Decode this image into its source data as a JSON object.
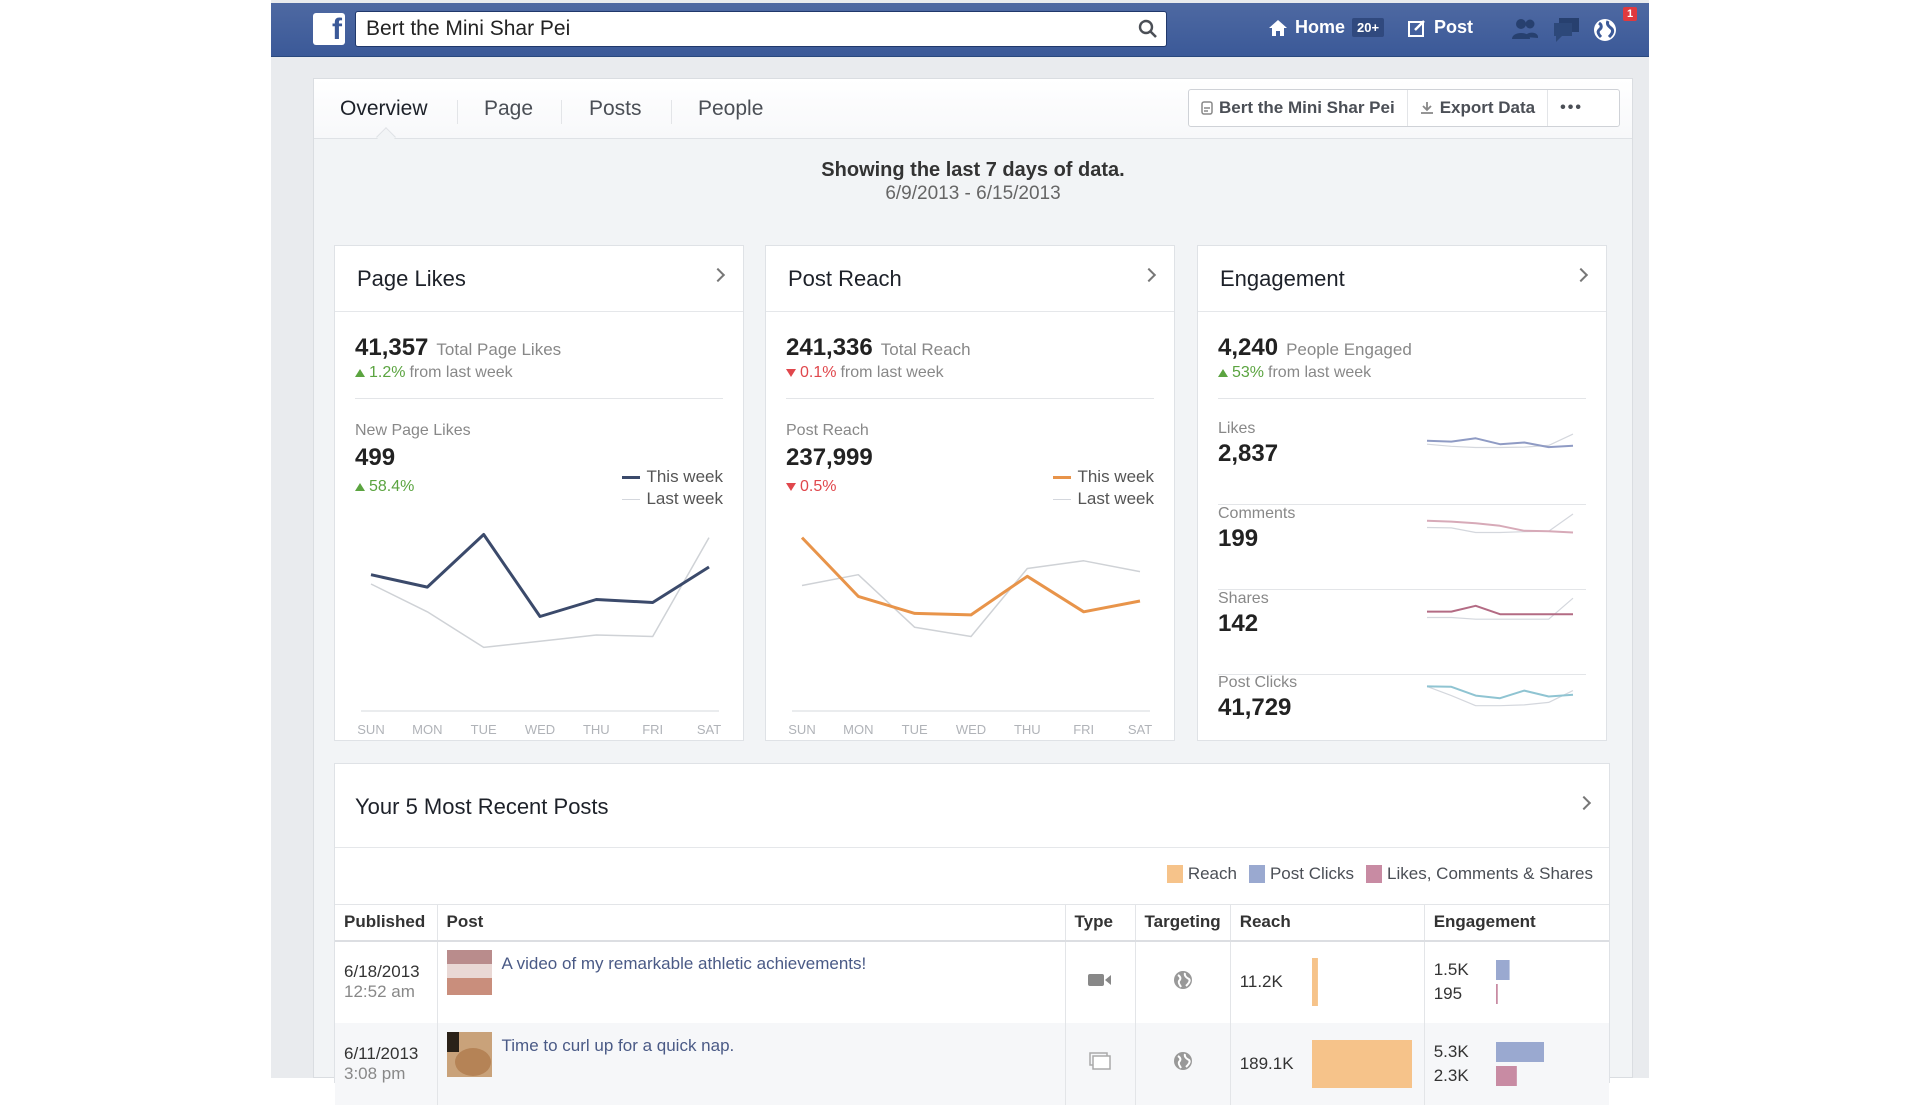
{
  "topbar": {
    "logo": "f",
    "search_value": "Bert the Mini Shar Pei",
    "nav": [
      {
        "label": "Home",
        "badge": "20+",
        "icon": "home-icon"
      },
      {
        "label": "Post",
        "icon": "post-edit-icon"
      }
    ],
    "jewels": [
      {
        "icon": "friend-requests-icon"
      },
      {
        "icon": "messages-icon"
      },
      {
        "icon": "notifications-globe-icon",
        "count": "1"
      }
    ]
  },
  "tabs": [
    {
      "label": "Overview",
      "active": true
    },
    {
      "label": "Page",
      "active": false
    },
    {
      "label": "Posts",
      "active": false
    },
    {
      "label": "People",
      "active": false
    }
  ],
  "actions": {
    "page_label": "Bert the Mini Shar Pei",
    "export_label": "Export Data",
    "more_label": "•••"
  },
  "range": {
    "title": "Showing the last 7 days of data.",
    "dates": "6/9/2013 - 6/15/2013"
  },
  "cards": {
    "page_likes": {
      "title": "Page Likes",
      "total": "41,357",
      "total_label": "Total Page Likes",
      "change": "1.2%",
      "change_dir": "up",
      "change_suffix": "from last week",
      "sub_label": "New Page Likes",
      "sub_value": "499",
      "sub_change": "58.4%",
      "sub_change_dir": "up",
      "legend_this": "This week",
      "legend_last": "Last week"
    },
    "post_reach": {
      "title": "Post Reach",
      "total": "241,336",
      "total_label": "Total Reach",
      "change": "0.1%",
      "change_dir": "down",
      "change_suffix": "from last week",
      "sub_label": "Post Reach",
      "sub_value": "237,999",
      "sub_change": "0.5%",
      "sub_change_dir": "down",
      "legend_this": "This week",
      "legend_last": "Last week"
    },
    "engagement": {
      "title": "Engagement",
      "total": "4,240",
      "total_label": "People Engaged",
      "change": "53%",
      "change_dir": "up",
      "change_suffix": "from last week",
      "rows": [
        {
          "label": "Likes",
          "value": "2,837"
        },
        {
          "label": "Comments",
          "value": "199"
        },
        {
          "label": "Shares",
          "value": "142"
        },
        {
          "label": "Post Clicks",
          "value": "41,729"
        }
      ]
    }
  },
  "chart_data": [
    {
      "type": "line",
      "title": "New Page Likes",
      "categories": [
        "SUN",
        "MON",
        "TUE",
        "WED",
        "THU",
        "FRI",
        "SAT"
      ],
      "series": [
        {
          "name": "This week",
          "color": "#3b4a6b",
          "values": [
            72,
            64,
            98,
            45,
            56,
            54,
            77
          ]
        },
        {
          "name": "Last week",
          "color": "#cfd2d6",
          "values": [
            66,
            48,
            25,
            29,
            33,
            32,
            96
          ]
        }
      ],
      "ylim": [
        0,
        110
      ]
    },
    {
      "type": "line",
      "title": "Post Reach",
      "categories": [
        "SUN",
        "MON",
        "TUE",
        "WED",
        "THU",
        "FRI",
        "SAT"
      ],
      "series": [
        {
          "name": "This week",
          "color": "#e8944a",
          "values": [
            96,
            58,
            47,
            46,
            71,
            48,
            55
          ]
        },
        {
          "name": "Last week",
          "color": "#cfd2d6",
          "values": [
            65,
            72,
            38,
            32,
            76,
            81,
            74
          ]
        }
      ],
      "ylim": [
        0,
        110
      ]
    },
    {
      "type": "line",
      "title": "Likes",
      "categories": [
        "SUN",
        "MON",
        "TUE",
        "WED",
        "THU",
        "FRI",
        "SAT"
      ],
      "series": [
        {
          "name": "This week",
          "color": "#8f9bc4",
          "values": [
            60,
            58,
            66,
            52,
            56,
            45,
            48
          ]
        },
        {
          "name": "Last week",
          "color": "#d4d7dd",
          "values": [
            52,
            47,
            44,
            44,
            45,
            49,
            76
          ]
        }
      ],
      "ylim": [
        0,
        100
      ]
    },
    {
      "type": "line",
      "title": "Comments",
      "categories": [
        "SUN",
        "MON",
        "TUE",
        "WED",
        "THU",
        "FRI",
        "SAT"
      ],
      "series": [
        {
          "name": "This week",
          "color": "#d7aab8",
          "values": [
            72,
            70,
            66,
            60,
            48,
            47,
            44
          ]
        },
        {
          "name": "Last week",
          "color": "#d4d7dd",
          "values": [
            56,
            55,
            44,
            44,
            46,
            47,
            88
          ]
        }
      ],
      "ylim": [
        0,
        100
      ]
    },
    {
      "type": "line",
      "title": "Shares",
      "categories": [
        "SUN",
        "MON",
        "TUE",
        "WED",
        "THU",
        "FRI",
        "SAT"
      ],
      "series": [
        {
          "name": "This week",
          "color": "#b36b84",
          "values": [
            58,
            58,
            72,
            52,
            52,
            52,
            52
          ]
        },
        {
          "name": "Last week",
          "color": "#d4d7dd",
          "values": [
            44,
            44,
            40,
            40,
            40,
            40,
            90
          ]
        }
      ],
      "ylim": [
        0,
        100
      ]
    },
    {
      "type": "line",
      "title": "Post Clicks",
      "categories": [
        "SUN",
        "MON",
        "TUE",
        "WED",
        "THU",
        "FRI",
        "SAT"
      ],
      "series": [
        {
          "name": "This week",
          "color": "#8fc4d2",
          "values": [
            80,
            79,
            58,
            52,
            70,
            56,
            60
          ]
        },
        {
          "name": "Last week",
          "color": "#d4d7dd",
          "values": [
            80,
            58,
            34,
            34,
            36,
            42,
            70
          ]
        }
      ],
      "ylim": [
        0,
        100
      ]
    }
  ],
  "posts": {
    "title": "Your 5 Most Recent Posts",
    "legend": [
      {
        "label": "Reach",
        "color": "#f6c38a"
      },
      {
        "label": "Post Clicks",
        "color": "#9aa9d0"
      },
      {
        "label": "Likes, Comments & Shares",
        "color": "#c88ba3"
      }
    ],
    "columns": [
      "Published",
      "Post",
      "Type",
      "Targeting",
      "Reach",
      "Engagement"
    ],
    "rows": [
      {
        "date": "6/18/2013",
        "time": "12:52 am",
        "text": "A video of my remarkable athletic achievements!",
        "type_icon": "video-icon",
        "targeting_icon": "public-globe-icon",
        "reach": "11.2K",
        "reach_value": 11200,
        "clicks": "1.5K",
        "clicks_value": 1500,
        "lcs": "195",
        "lcs_value": 195
      },
      {
        "date": "6/11/2013",
        "time": "3:08 pm",
        "text": "Time to curl up for a quick nap.",
        "type_icon": "photo-album-icon",
        "targeting_icon": "public-globe-icon",
        "reach": "189.1K",
        "reach_value": 189100,
        "clicks": "5.3K",
        "clicks_value": 5300,
        "lcs": "2.3K",
        "lcs_value": 2300
      }
    ]
  }
}
